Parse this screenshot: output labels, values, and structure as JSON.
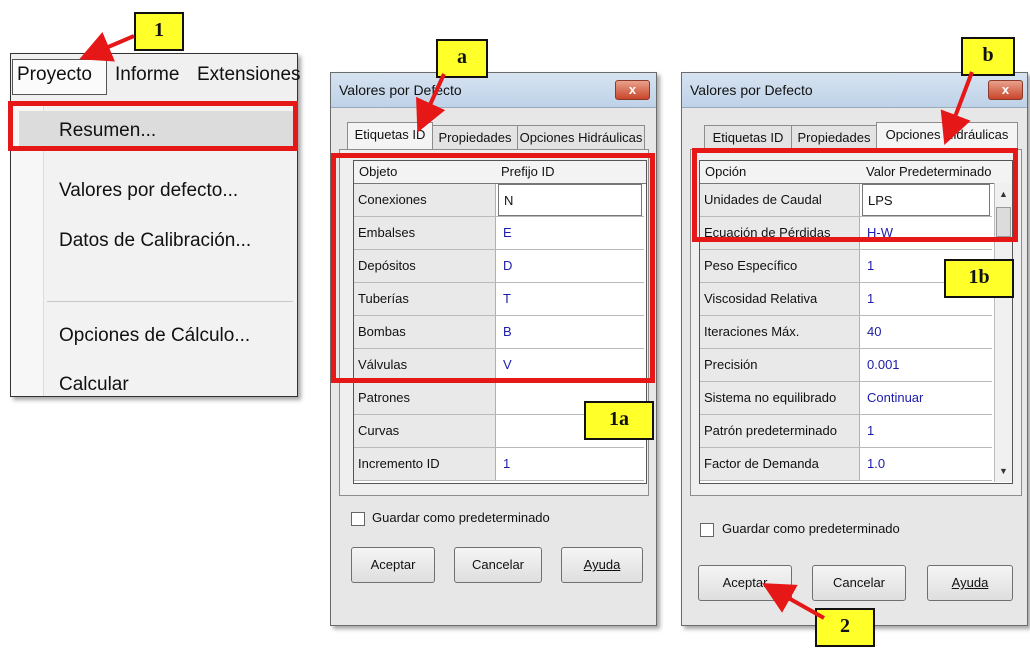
{
  "menu": {
    "bar_items": [
      "Proyecto",
      "Informe",
      "Extensiones"
    ],
    "dropdown_items": [
      "Resumen...",
      "Valores por defecto...",
      "Datos de Calibración...",
      "Opciones de Cálculo...",
      "Calcular"
    ]
  },
  "dialog_a": {
    "title": "Valores por Defecto",
    "close": "x",
    "tabs": [
      "Etiquetas ID",
      "Propiedades",
      "Opciones Hidráulicas"
    ],
    "active_tab": "Etiquetas ID",
    "columns": [
      "Objeto",
      "Prefijo ID"
    ],
    "rows": [
      {
        "name": "Conexiones",
        "value": "N"
      },
      {
        "name": "Embalses",
        "value": "E"
      },
      {
        "name": "Depósitos",
        "value": "D"
      },
      {
        "name": "Tuberías",
        "value": "T"
      },
      {
        "name": "Bombas",
        "value": "B"
      },
      {
        "name": "Válvulas",
        "value": "V"
      },
      {
        "name": "Patrones",
        "value": ""
      },
      {
        "name": "Curvas",
        "value": ""
      },
      {
        "name": "Incremento ID",
        "value": "1"
      }
    ],
    "checkbox_label": "Guardar como predeterminado",
    "buttons": {
      "ok": "Aceptar",
      "cancel": "Cancelar",
      "help": "Ayuda"
    }
  },
  "dialog_b": {
    "title": "Valores por Defecto",
    "close": "x",
    "tabs": [
      "Etiquetas ID",
      "Propiedades",
      "Opciones Hidráulicas"
    ],
    "active_tab": "Opciones Hidráulicas",
    "columns": [
      "Opción",
      "Valor Predeterminado"
    ],
    "rows": [
      {
        "name": "Unidades de Caudal",
        "value": "LPS"
      },
      {
        "name": "Ecuación de Pérdidas",
        "value": "H-W"
      },
      {
        "name": "Peso Específico",
        "value": "1"
      },
      {
        "name": "Viscosidad Relativa",
        "value": "1"
      },
      {
        "name": "Iteraciones Máx.",
        "value": "40"
      },
      {
        "name": "Precisión",
        "value": "0.001"
      },
      {
        "name": "Sistema no equilibrado",
        "value": "Continuar"
      },
      {
        "name": "Patrón predeterminado",
        "value": "1"
      },
      {
        "name": "Factor de Demanda",
        "value": "1.0"
      }
    ],
    "checkbox_label": "Guardar como predeterminado",
    "buttons": {
      "ok": "Aceptar",
      "cancel": "Cancelar",
      "help": "Ayuda"
    }
  },
  "annotations": {
    "labels": [
      "1",
      "a",
      "b",
      "1a",
      "1b",
      "2"
    ],
    "color_box": "#e51717",
    "color_callout": "#ffff2a"
  }
}
